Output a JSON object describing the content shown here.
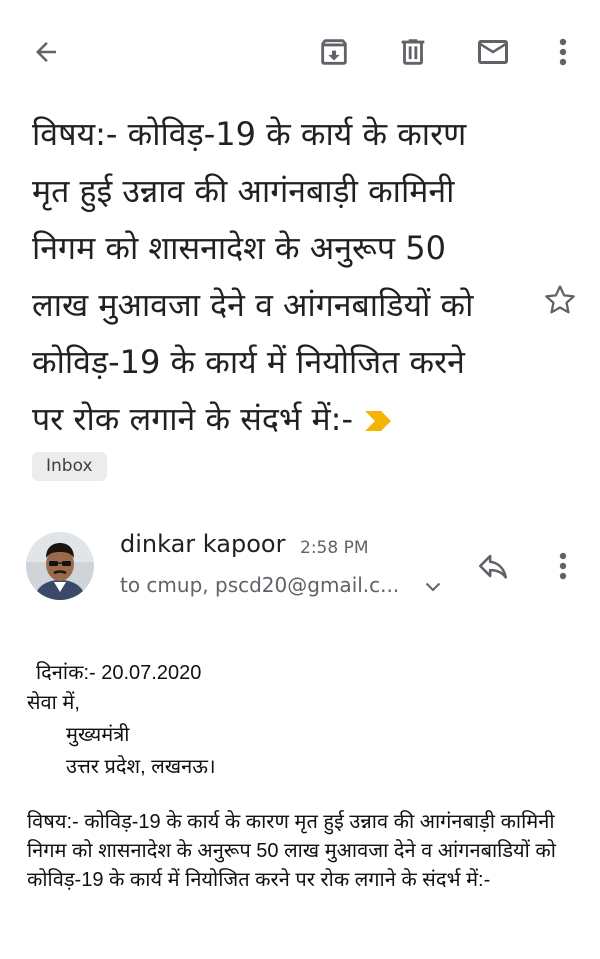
{
  "toolbar": {
    "icons": [
      "back-arrow-icon",
      "archive-icon",
      "delete-icon",
      "mark-unread-icon",
      "more-vert-icon"
    ]
  },
  "subject": {
    "text": "विषय:- कोविड़-19 के कार्य के कारण मृत हुई उन्नाव की आगंनबाड़ी कामिनी निगम को शासनादेश के अनुरूप 50 लाख मुआवजा देने व आंगनबाडियों को कोविड़-19 के कार्य में नियोजित करने पर रोक लगाने के संदर्भ में:-",
    "label_chip": "Inbox"
  },
  "message": {
    "sender_name": "dinkar kapoor",
    "time": "2:58 PM",
    "recipients": "to cmup, pscd20@gmail.c..."
  },
  "body": {
    "date_line": "दिनांक:- 20.07.2020",
    "salutation": "सेवा में,",
    "addressee_1": "मुख्यमंत्री",
    "addressee_2": "उत्तर प्रदेश, लखनऊ।",
    "subject_para": "विषय:- कोविड़-19 के कार्य के कारण मृत हुई उन्नाव की आगंनबाड़ी कामिनी निगम को शासनादेश के अनुरूप 50 लाख मुआवजा देने व आंगनबाडियों को कोविड़-19 के कार्य में नियोजित करने पर रोक लगाने के संदर्भ में:-"
  },
  "colors": {
    "importance_marker": "#f4b400",
    "icon_gray": "#5f6368",
    "chip_bg": "#ececec"
  }
}
